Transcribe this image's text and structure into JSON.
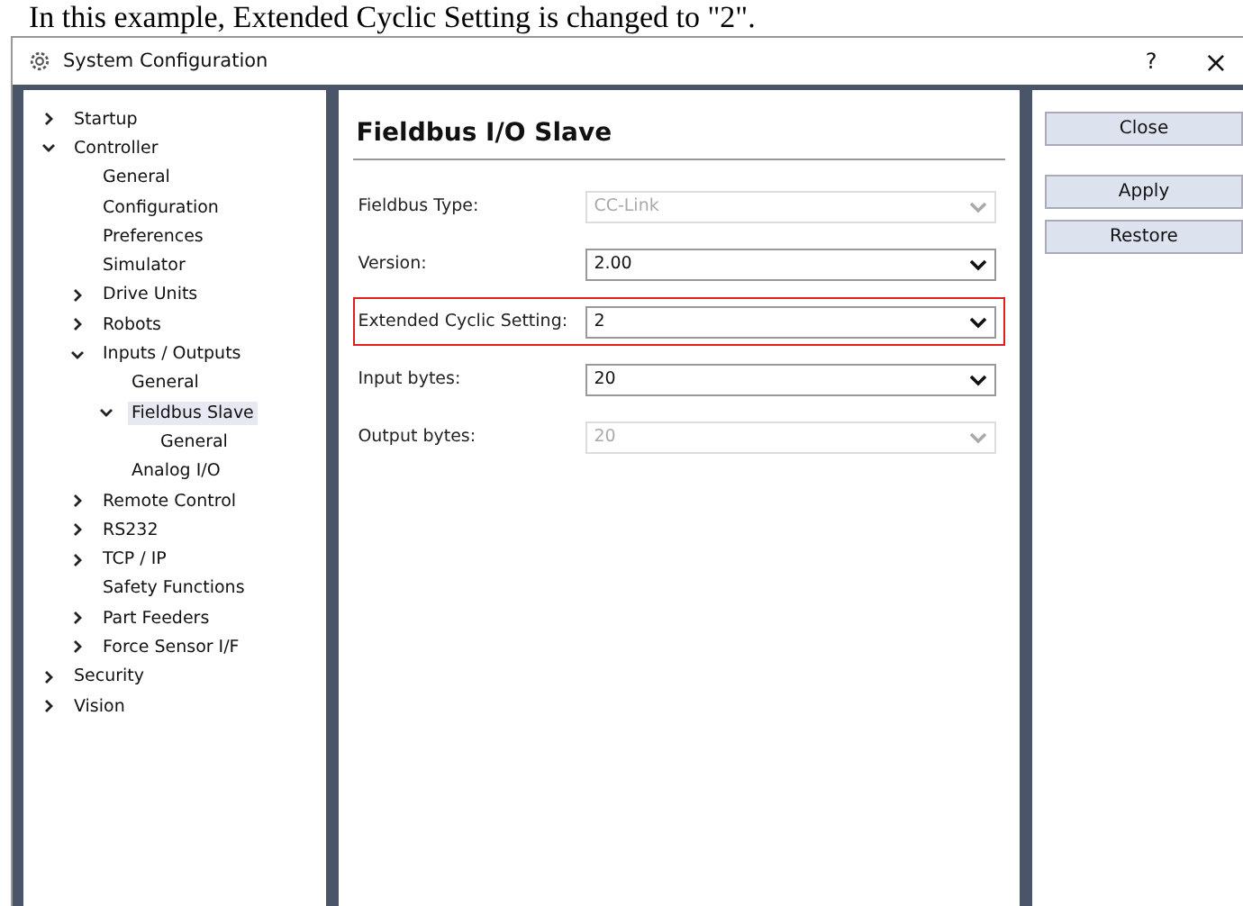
{
  "caption": "In this example, Extended Cyclic Setting is changed to \"2\".",
  "window": {
    "title": "System Configuration",
    "help": "?",
    "close": "×"
  },
  "tree": [
    {
      "label": "Startup",
      "expanded": false,
      "selected": false
    },
    {
      "label": "Controller",
      "expanded": true,
      "selected": false,
      "children": [
        {
          "label": "General",
          "selected": false
        },
        {
          "label": "Configuration",
          "selected": false
        },
        {
          "label": "Preferences",
          "selected": false
        },
        {
          "label": "Simulator",
          "selected": false
        },
        {
          "label": "Drive Units",
          "expanded": false,
          "selected": false
        },
        {
          "label": "Robots",
          "expanded": false,
          "selected": false
        },
        {
          "label": "Inputs / Outputs",
          "expanded": true,
          "selected": false,
          "children": [
            {
              "label": "General",
              "selected": false
            },
            {
              "label": "Fieldbus Slave",
              "expanded": true,
              "selected": true,
              "children": [
                {
                  "label": "General",
                  "selected": false
                }
              ]
            },
            {
              "label": "Analog I/O",
              "selected": false
            }
          ]
        },
        {
          "label": "Remote Control",
          "expanded": false,
          "selected": false
        },
        {
          "label": "RS232",
          "expanded": false,
          "selected": false
        },
        {
          "label": "TCP / IP",
          "expanded": false,
          "selected": false
        },
        {
          "label": "Safety Functions",
          "selected": false
        },
        {
          "label": "Part Feeders",
          "expanded": false,
          "selected": false
        },
        {
          "label": "Force Sensor I/F",
          "expanded": false,
          "selected": false
        }
      ]
    },
    {
      "label": "Security",
      "expanded": false,
      "selected": false
    },
    {
      "label": "Vision",
      "expanded": false,
      "selected": false
    }
  ],
  "panel": {
    "heading": "Fieldbus I/O Slave",
    "fields": [
      {
        "label": "Fieldbus Type:",
        "value": "CC-Link",
        "disabled": true,
        "highlighted": false
      },
      {
        "label": "Version:",
        "value": "2.00",
        "disabled": false,
        "highlighted": false
      },
      {
        "label": "Extended Cyclic Setting:",
        "value": "2",
        "disabled": false,
        "highlighted": true
      },
      {
        "label": "Input bytes:",
        "value": "20",
        "disabled": false,
        "highlighted": false
      },
      {
        "label": "Output bytes:",
        "value": "20",
        "disabled": true,
        "highlighted": false
      }
    ]
  },
  "buttons": [
    "Close",
    "Apply",
    "Restore"
  ]
}
